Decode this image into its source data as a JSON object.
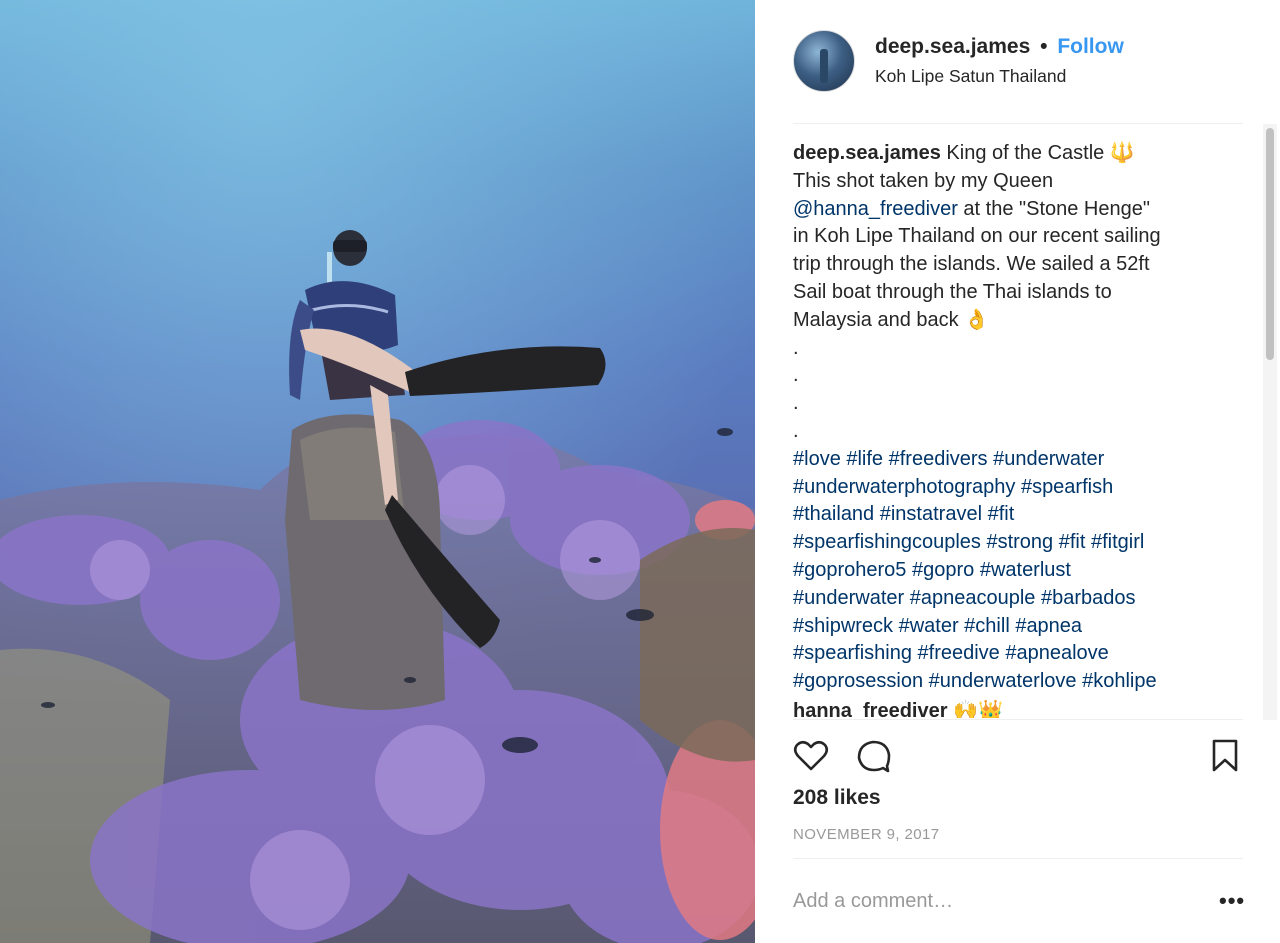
{
  "post": {
    "username": "deep.sea.james",
    "separator": "•",
    "follow_label": "Follow",
    "location": "Koh Lipe Satun Thailand"
  },
  "caption": {
    "username": "deep.sea.james",
    "line1": " King of the Castle 🔱",
    "line2": "This shot taken by my Queen",
    "mention": "@hanna_freediver",
    "line3_rest": " at the \"Stone Henge\"",
    "line4": "in Koh Lipe Thailand on our recent sailing",
    "line5": "trip through the islands. We sailed a 52ft",
    "line6": "Sail boat through the Thai islands to",
    "line7": "Malaysia and back 👌",
    "dots": [
      ".",
      ".",
      ".",
      "."
    ],
    "hashtag_lines": [
      "#love #life #freedivers #underwater",
      "#underwaterphotography #spearfish",
      "#thailand #instatravel #fit",
      "#spearfishingcouples #strong #fit #fitgirl",
      "#goprohero5 #gopro #waterlust",
      "#underwater #apneacouple #barbados",
      "#shipwreck #water #chill #apnea",
      "#spearfishing #freedive #apnealove",
      "#goprosession #underwaterlove #kohlipe"
    ],
    "next_comment": "hanna_freediver 🙌👑"
  },
  "actions": {
    "like_icon": "heart-icon",
    "comment_icon": "comment-icon",
    "save_icon": "bookmark-icon"
  },
  "likes": "208 likes",
  "date": "NOVEMBER 9, 2017",
  "comment_box": {
    "placeholder": "Add a comment…",
    "more_label": "•••"
  },
  "colors": {
    "link": "#003569",
    "follow": "#3897f0",
    "muted": "#999999",
    "text": "#262626"
  }
}
